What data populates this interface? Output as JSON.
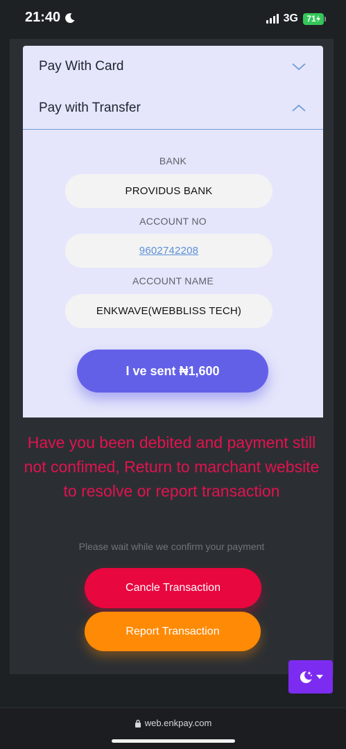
{
  "status_bar": {
    "time": "21:40",
    "network": "3G",
    "battery": "71"
  },
  "payment": {
    "card_label": "Pay With Card",
    "transfer_label": "Pay with Transfer",
    "bank_label": "BANK",
    "bank_value": "PROVIDUS BANK",
    "account_no_label": "ACCOUNT NO",
    "account_no_value": "9602742208",
    "account_name_label": "ACCOUNT NAME",
    "account_name_value": "ENKWAVE(WEBBLISS TECH)",
    "sent_button": "I ve sent ₦1,600"
  },
  "notice": {
    "warning": "Have you been debited and payment still not confimed, Return to marchant website to resolve or report transaction",
    "wait": "Please wait while we confirm your payment"
  },
  "actions": {
    "cancel": "Cancle Transaction",
    "report": "Report Transaction"
  },
  "browser": {
    "url": "web.enkpay.com"
  },
  "icons": {
    "moon": "moon-icon",
    "chevron_down": "chevron-down-icon",
    "chevron_up": "chevron-up-icon",
    "lock": "lock-icon",
    "theme_toggle": "moon-stars-icon"
  },
  "colors": {
    "primary": "#6360e8",
    "danger": "#e8073f",
    "warning_text": "#e3124f",
    "report": "#ff8a05",
    "toggle": "#7c2cf0"
  }
}
